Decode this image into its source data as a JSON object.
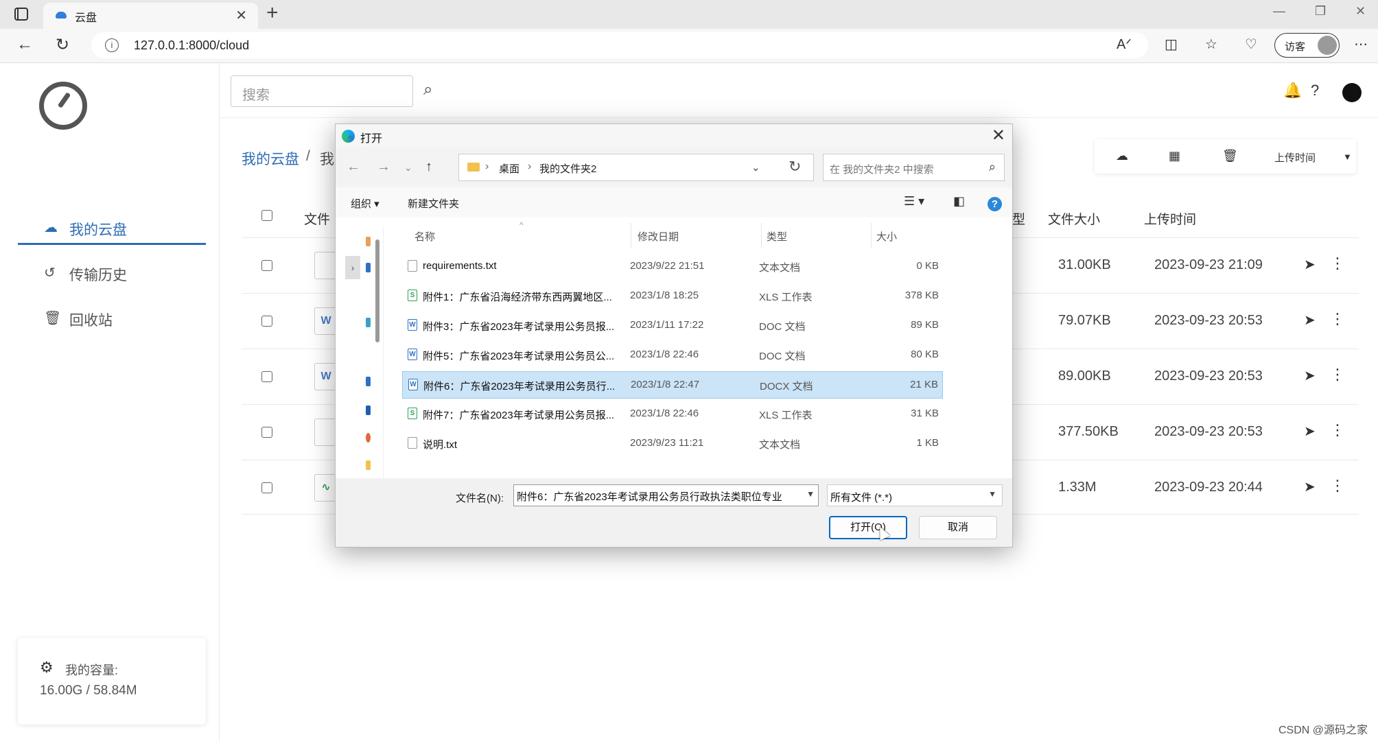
{
  "browser": {
    "tab_title": "云盘",
    "url": "127.0.0.1:8000/cloud",
    "guest_label": "访客"
  },
  "sidebar": {
    "items": [
      {
        "label": "我的云盘",
        "icon": "cloud-icon",
        "active": true
      },
      {
        "label": "传输历史",
        "icon": "history-icon",
        "active": false
      },
      {
        "label": "回收站",
        "icon": "trash-icon",
        "active": false
      }
    ],
    "capacity_label": "我的容量:",
    "capacity_value": "16.00G / 58.84M"
  },
  "header": {
    "search_placeholder": "搜索"
  },
  "breadcrumb": {
    "root": "我的云盘",
    "separator": "/",
    "current": "我"
  },
  "toolbar": {
    "sort_label": "上传时间"
  },
  "table": {
    "headers": {
      "name": "文件",
      "type": "型",
      "size": "文件大小",
      "uploaded": "上传时间"
    },
    "rows": [
      {
        "icon": "file-icon",
        "size": "31.00KB",
        "time": "2023-09-23 21:09"
      },
      {
        "icon": "word-icon",
        "size": "79.07KB",
        "time": "2023-09-23 20:53"
      },
      {
        "icon": "word-icon",
        "size": "89.00KB",
        "time": "2023-09-23 20:53"
      },
      {
        "icon": "file-icon",
        "size": "377.50KB",
        "time": "2023-09-23 20:53"
      },
      {
        "icon": "image-icon",
        "size": "1.33M",
        "time": "2023-09-23 20:44"
      }
    ]
  },
  "dialog": {
    "title": "打开",
    "path": [
      "桌面",
      "我的文件夹2"
    ],
    "search_placeholder": "在 我的文件夹2 中搜索",
    "organize_label": "组织 ▾",
    "new_folder_label": "新建文件夹",
    "columns": {
      "name": "名称",
      "date": "修改日期",
      "type": "类型",
      "size": "大小"
    },
    "files": [
      {
        "name": "requirements.txt",
        "date": "2023/9/22 21:51",
        "type": "文本文档",
        "size": "0 KB",
        "kind": "txt"
      },
      {
        "name": "附件1：广东省沿海经济带东西两翼地区...",
        "date": "2023/1/8 18:25",
        "type": "XLS 工作表",
        "size": "378 KB",
        "kind": "xls"
      },
      {
        "name": "附件3：广东省2023年考试录用公务员报...",
        "date": "2023/1/11 17:22",
        "type": "DOC 文档",
        "size": "89 KB",
        "kind": "doc"
      },
      {
        "name": "附件5：广东省2023年考试录用公务员公...",
        "date": "2023/1/8 22:46",
        "type": "DOC 文档",
        "size": "80 KB",
        "kind": "doc"
      },
      {
        "name": "附件6：广东省2023年考试录用公务员行...",
        "date": "2023/1/8 22:47",
        "type": "DOCX 文档",
        "size": "21 KB",
        "kind": "doc"
      },
      {
        "name": "附件7：广东省2023年考试录用公务员报...",
        "date": "2023/1/8 22:46",
        "type": "XLS 工作表",
        "size": "31 KB",
        "kind": "xls"
      },
      {
        "name": "说明.txt",
        "date": "2023/9/23 11:21",
        "type": "文本文档",
        "size": "1 KB",
        "kind": "txt"
      }
    ],
    "filename_label": "文件名(N):",
    "filename_value": "附件6：广东省2023年考试录用公务员行政执法类职位专业",
    "filetype_value": "所有文件 (*.*)",
    "open_button": "打开(O)",
    "cancel_button": "取消"
  },
  "watermark": "CSDN @源码之家",
  "colors": {
    "accent": "#2e6db4",
    "selection": "#cce4f7",
    "dialog_primary": "#0067c0"
  }
}
